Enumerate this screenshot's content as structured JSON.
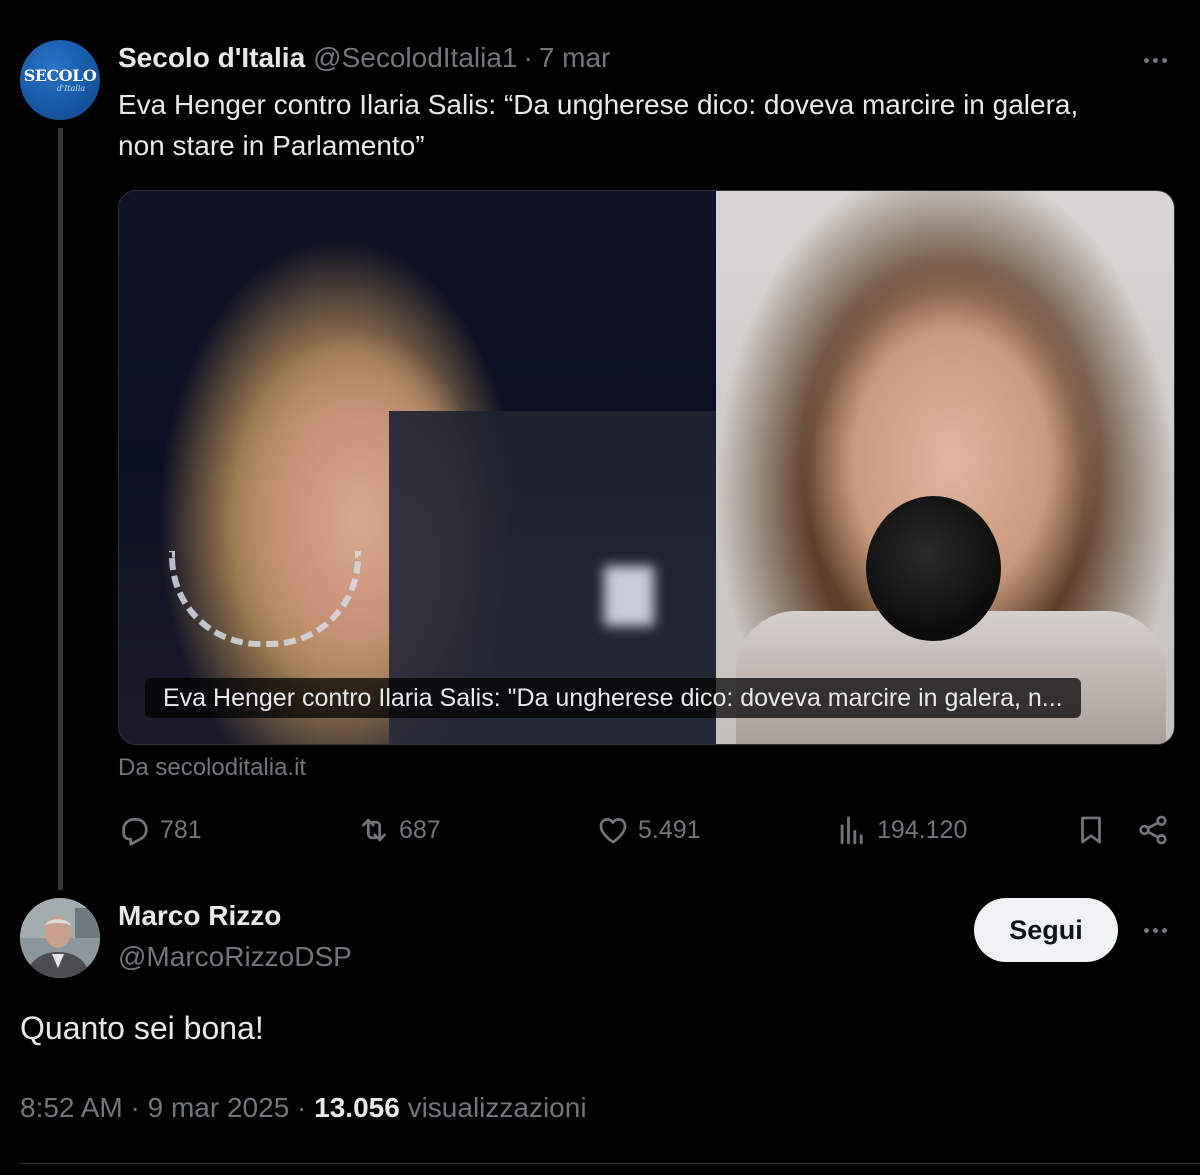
{
  "original_tweet": {
    "author_name": "Secolo d'Italia",
    "author_handle": "@SecolodItalia1",
    "separator": "·",
    "date": "7 mar",
    "avatar_text": "SECOLO",
    "avatar_subtext": "d'Italia",
    "text": "Eva Henger contro Ilaria Salis: “Da ungherese dico: doveva marcire in galera, non stare in Parlamento”",
    "card": {
      "caption": "Eva Henger contro Ilaria Salis: \"Da ungherese dico: doveva marcire in galera, n...",
      "source": "Da secoloditalia.it"
    },
    "actions": {
      "replies": "781",
      "reposts": "687",
      "likes": "5.491",
      "views": "194.120"
    }
  },
  "reply_tweet": {
    "author_name": "Marco Rizzo",
    "author_handle": "@MarcoRizzoDSP",
    "follow_label": "Segui",
    "text": "Quanto sei bona!",
    "time": "8:52 AM",
    "separator": "·",
    "date": "9 mar 2025",
    "views_count": "13.056",
    "views_label": "visualizzazioni"
  },
  "icons": {
    "reply": "reply-icon",
    "repost": "repost-icon",
    "like": "heart-icon",
    "views": "views-chart-icon",
    "bookmark": "bookmark-icon",
    "share": "share-icon",
    "more": "more-dots-icon"
  },
  "colors": {
    "background": "#000000",
    "text_primary": "#e7e9ea",
    "text_secondary": "#71767b",
    "follow_button_bg": "#eff3f4"
  }
}
